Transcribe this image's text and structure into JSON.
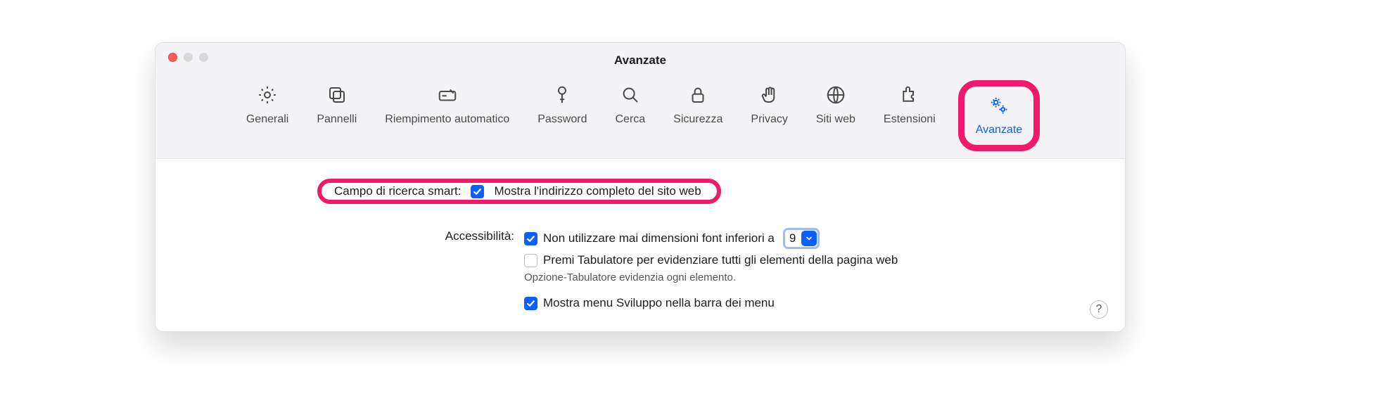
{
  "window": {
    "title": "Avanzate"
  },
  "tabs": {
    "general": {
      "label": "Generali"
    },
    "panels": {
      "label": "Pannelli"
    },
    "autofill": {
      "label": "Riempimento automatico"
    },
    "password": {
      "label": "Password"
    },
    "search": {
      "label": "Cerca"
    },
    "security": {
      "label": "Sicurezza"
    },
    "privacy": {
      "label": "Privacy"
    },
    "websites": {
      "label": "Siti web"
    },
    "extensions": {
      "label": "Estensioni"
    },
    "advanced": {
      "label": "Avanzate"
    }
  },
  "sections": {
    "smart_search": {
      "label": "Campo di ricerca smart:",
      "show_full_url": "Mostra l'indirizzo completo del sito web"
    },
    "accessibility": {
      "label": "Accessibilità:",
      "min_font_checkbox": "Non utilizzare mai dimensioni font inferiori a",
      "min_font_value": "9",
      "tab_highlight": "Premi Tabulatore per evidenziare tutti gli elementi della pagina web",
      "tab_hint": "Opzione-Tabulatore evidenzia ogni elemento."
    },
    "develop": {
      "label": "Mostra menu Sviluppo nella barra dei menu"
    }
  },
  "help": "?"
}
